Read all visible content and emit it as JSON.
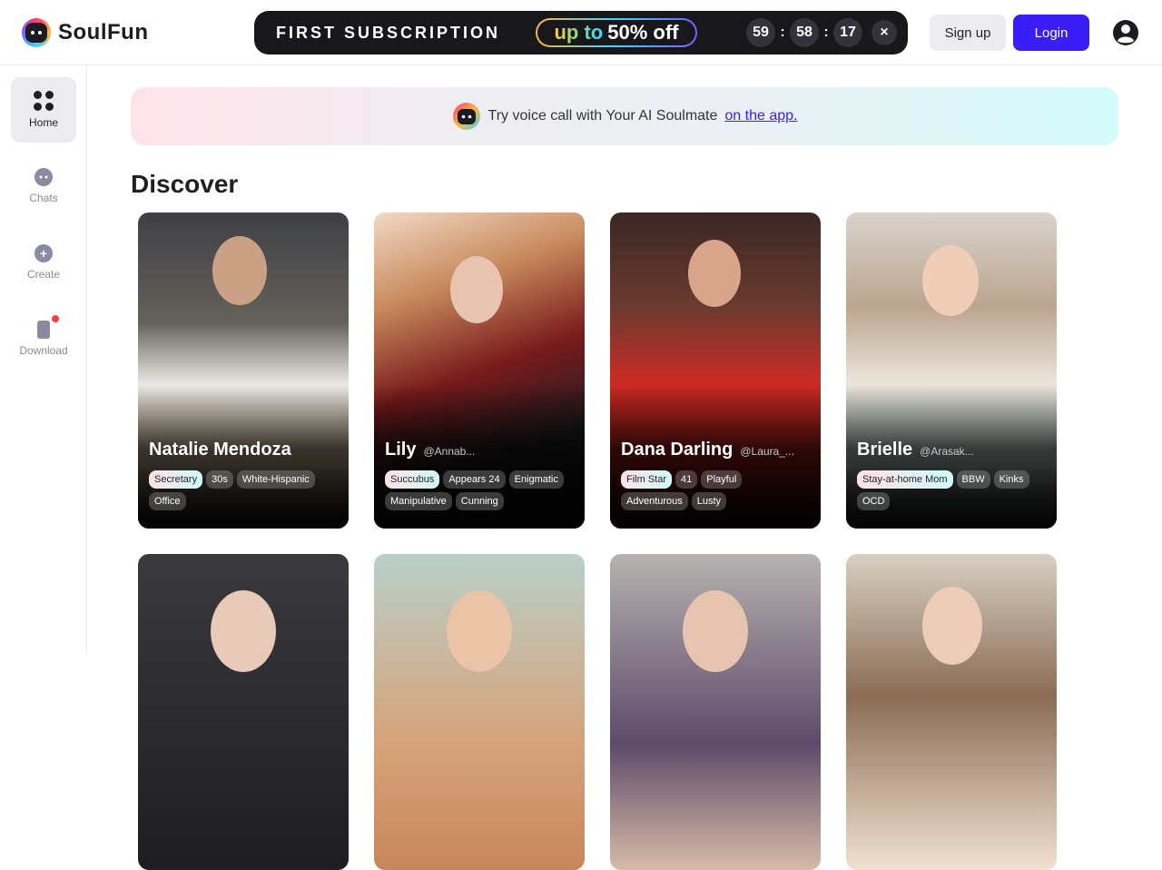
{
  "brand": {
    "name": "SoulFun"
  },
  "promo": {
    "title": "FIRST SUBSCRIPTION",
    "offer_prefix": "up to",
    "offer_value": "50% off",
    "timer": {
      "hours": "59",
      "minutes": "58",
      "seconds": "17",
      "separator": ":"
    },
    "close_label": "×"
  },
  "auth": {
    "signup_label": "Sign up",
    "login_label": "Login"
  },
  "sidebar": {
    "items": [
      {
        "label": "Home",
        "icon": "home-grid-icon",
        "active": true
      },
      {
        "label": "Chats",
        "icon": "chat-bubble-icon"
      },
      {
        "label": "Create",
        "icon": "plus-circle-icon"
      },
      {
        "label": "Download",
        "icon": "phone-icon",
        "badge": "red-dot"
      }
    ]
  },
  "banner": {
    "text": "Try voice call with Your AI Soulmate",
    "link": "on the app."
  },
  "discover": {
    "title": "Discover",
    "cards": [
      {
        "name": "Natalie Mendoza",
        "handle": "",
        "tags": [
          "Secretary",
          "30s",
          "White-Hispanic",
          "Office"
        ]
      },
      {
        "name": "Lily",
        "handle": "@Annab...",
        "tags": [
          "Succubus",
          "Appears 24",
          "Enigmatic",
          "Manipulative",
          "Cunning"
        ]
      },
      {
        "name": "Dana Darling",
        "handle": "@Laura_...",
        "tags": [
          "Film Star",
          "41",
          "Playful",
          "Adventurous",
          "Lusty"
        ]
      },
      {
        "name": "Brielle",
        "handle": "@Arasak...",
        "tags": [
          "Stay-at-home Mom",
          "BBW",
          "Kinks",
          "OCD"
        ]
      }
    ]
  },
  "colors": {
    "accent": "#3b1ef5",
    "promo_bg": "#17171c",
    "badge_red": "#ff3b3b"
  }
}
